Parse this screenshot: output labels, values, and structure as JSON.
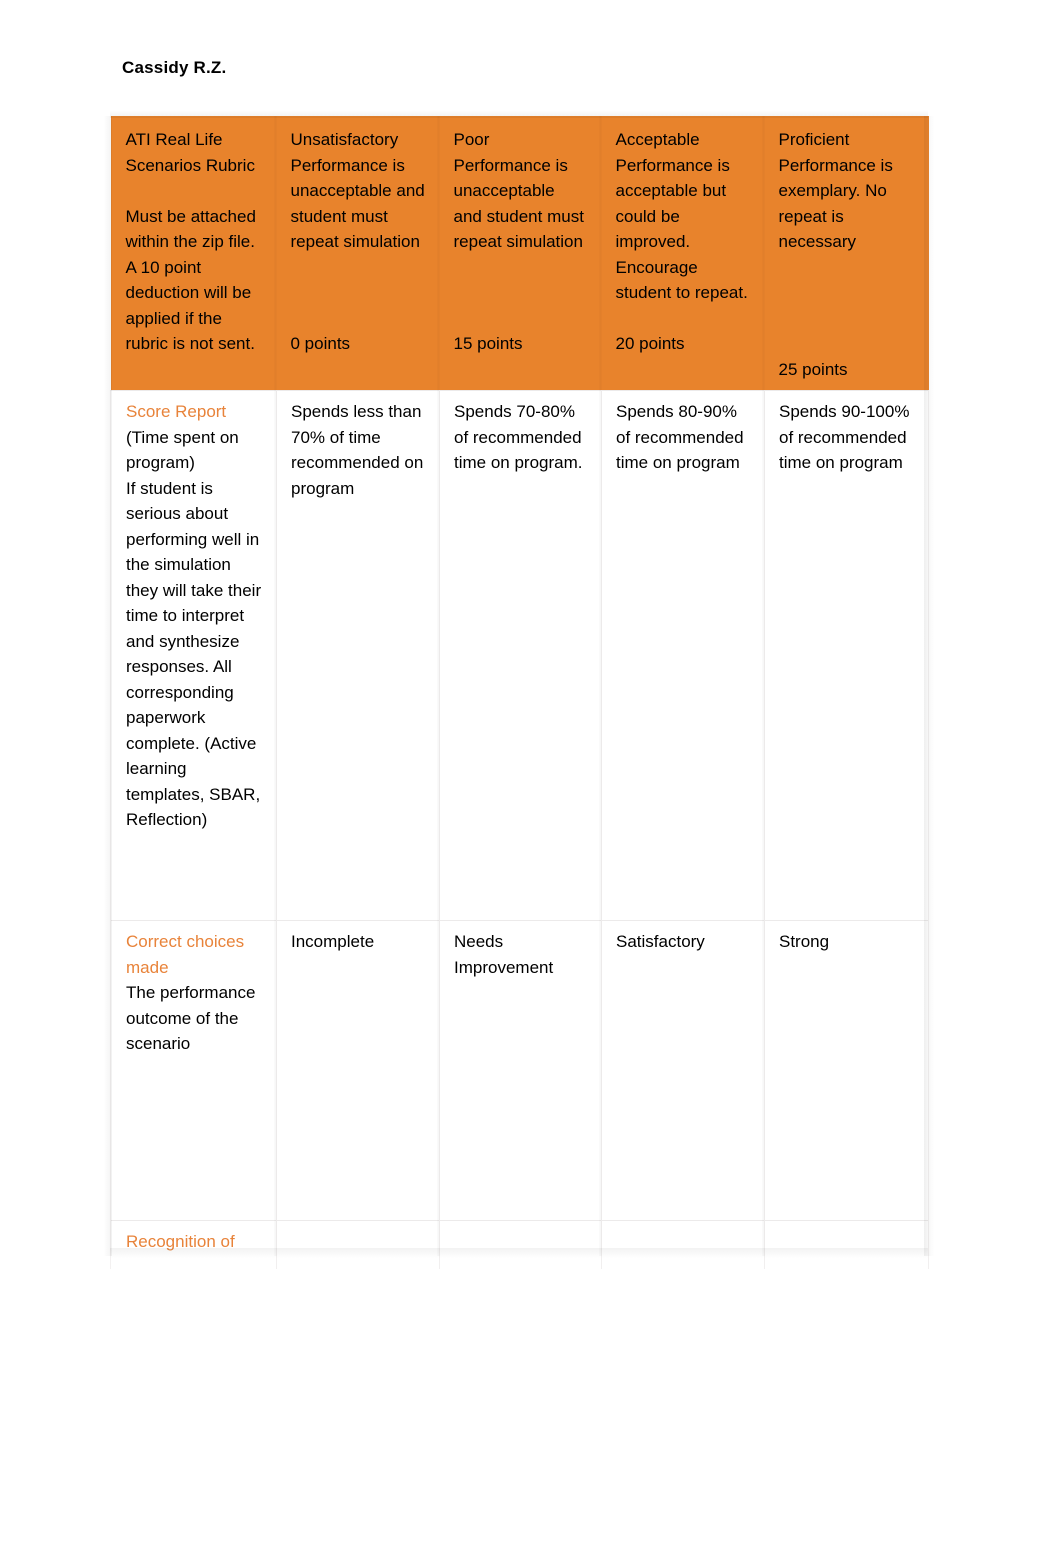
{
  "document": {
    "author_header": "Cassidy R.Z."
  },
  "theme": {
    "header_fill": "#E8832C",
    "criterion_text": "#E8833A",
    "body_text": "#000000",
    "page_background": "#FFFFFF"
  },
  "table": {
    "header_row": {
      "criteria_cell": {
        "title": "ATI Real Life Scenarios Rubric",
        "note": "Must be attached within the zip file.  A 10 point deduction will be applied if the rubric is not sent."
      },
      "levels": [
        {
          "label": "Unsatisfactory",
          "description": "Performance is unacceptable and student must repeat simulation",
          "points": "0 points"
        },
        {
          "label": "Poor",
          "description": "Performance is unacceptable and student must repeat simulation",
          "points": "15 points"
        },
        {
          "label": "Acceptable",
          "description": "Performance is acceptable but could be improved. Encourage student to repeat.",
          "points": "20 points"
        },
        {
          "label": "Proficient",
          "description": "Performance is exemplary. No repeat is necessary",
          "points": "25 points"
        }
      ]
    },
    "rows": [
      {
        "criterion_title": "Score Report",
        "criterion_body": "(Time spent on program)\nIf student is serious about performing well in the simulation they will take their time to interpret and synthesize responses. All corresponding paperwork complete. (Active learning templates, SBAR, Reflection)",
        "cells": [
          "Spends less than 70% of time recommended on program",
          "Spends 70-80% of recommended time on program.",
          "Spends 80-90% of recommended time on program",
          "Spends 90-100% of recommended time on program"
        ]
      },
      {
        "criterion_title": "Correct choices made",
        "criterion_body": "The performance outcome of the scenario",
        "cells": [
          "Incomplete",
          "Needs Improvement",
          "Satisfactory",
          "Strong"
        ]
      },
      {
        "criterion_title": "Recognition of",
        "criterion_body": "",
        "cells": [
          "",
          "",
          "",
          ""
        ]
      }
    ]
  }
}
